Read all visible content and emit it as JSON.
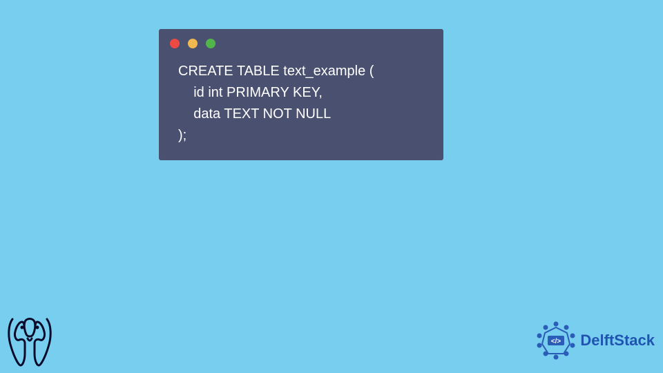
{
  "code_window": {
    "dots": [
      "red",
      "yellow",
      "green"
    ],
    "lines": [
      "CREATE TABLE text_example (",
      "    id int PRIMARY KEY,",
      "    data TEXT NOT NULL",
      ");"
    ]
  },
  "logos": {
    "postgres_alt": "PostgreSQL elephant logo",
    "delftstack_text": "DelftStack",
    "delftstack_badge_alt": "DelftStack badge"
  },
  "colors": {
    "background": "#78ceee",
    "window": "#4a506f",
    "code_text": "#ffffff",
    "brand_blue": "#1f55b0"
  }
}
